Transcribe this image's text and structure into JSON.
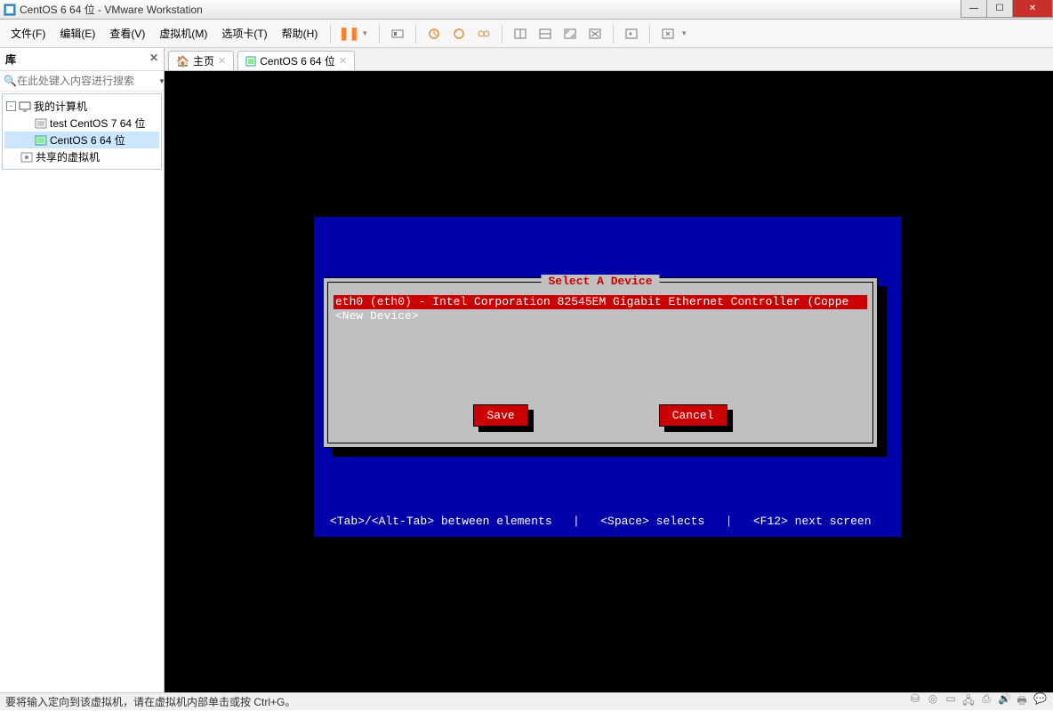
{
  "window": {
    "title": "CentOS 6 64 位 - VMware Workstation"
  },
  "menu": {
    "items": [
      "文件(F)",
      "编辑(E)",
      "查看(V)",
      "虚拟机(M)",
      "选项卡(T)",
      "帮助(H)"
    ]
  },
  "toolbar_icons": {
    "pause": "pause-icon",
    "power": "power-icon",
    "snapshot": "snapshot-icon",
    "revert": "revert-icon",
    "manage": "manage-icon",
    "view1": "view-single-icon",
    "view2": "view-split-icon",
    "full": "fullscreen-icon",
    "unity": "unity-icon",
    "cycle": "cycle-icon",
    "stretch": "stretch-icon"
  },
  "sidebar": {
    "title": "库",
    "search_placeholder": "在此处键入内容进行搜索",
    "root": {
      "label": "我的计算机"
    },
    "items": [
      {
        "label": "test CentOS 7 64 位"
      },
      {
        "label": "CentOS 6 64 位"
      }
    ],
    "shared": {
      "label": "共享的虚拟机"
    }
  },
  "tabs": {
    "home": "主页",
    "vm": "CentOS 6 64 位"
  },
  "dialog": {
    "title": "Select A Device",
    "rows": [
      "eth0 (eth0) - Intel Corporation 82545EM Gigabit Ethernet Controller (Coppe",
      "<New Device>"
    ],
    "save": "Save",
    "cancel": "Cancel"
  },
  "console": {
    "hint": "<Tab>/<Alt-Tab> between elements   |   <Space> selects   |   <F12> next screen"
  },
  "status": {
    "text": "要将输入定向到该虚拟机，请在虚拟机内部单击或按 Ctrl+G。"
  }
}
